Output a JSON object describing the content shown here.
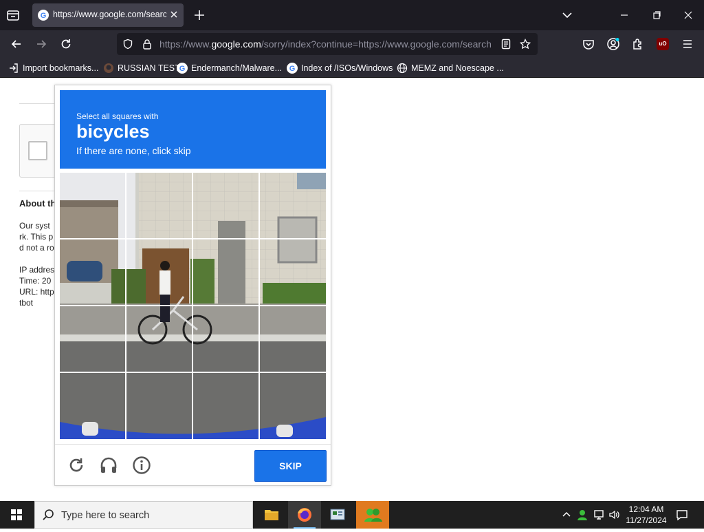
{
  "browser": {
    "tab_title": "https://www.google.com/search",
    "url_prefix": "https://www.",
    "url_domain": "google.com",
    "url_rest": "/sorry/index?continue=https://www.google.com/search",
    "bookmarks": [
      "Import bookmarks...",
      "RUSSIAN TEST",
      "Endermanch/Malware...",
      "Index of /ISOs/Windows",
      "MEMZ and Noescape ..."
    ]
  },
  "page": {
    "about_heading": "About th",
    "para1": [
      "Our syst",
      "rk. This p",
      "d not a ro"
    ],
    "para2": [
      "IP addres",
      "Time: 20",
      "URL: http",
      "tbot"
    ]
  },
  "captcha": {
    "instruction_line1": "Select all squares with",
    "target": "bicycles",
    "instruction_line3": "If there are none, click skip",
    "skip_label": "SKIP"
  },
  "taskbar": {
    "search_placeholder": "Type here to search",
    "time": "12:04 AM",
    "date": "11/27/2024"
  },
  "colors": {
    "captcha_blue": "#1a73e8",
    "chrome_dark": "#1c1b22",
    "toolbar": "#2b2a33"
  }
}
